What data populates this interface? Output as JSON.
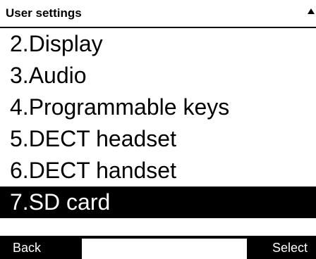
{
  "header": {
    "title": "User settings",
    "scroll_indicator": "triangle-up-icon"
  },
  "menu": {
    "items": [
      {
        "label": "2.Display",
        "selected": false
      },
      {
        "label": "3.Audio",
        "selected": false
      },
      {
        "label": "4.Programmable keys",
        "selected": false
      },
      {
        "label": "5.DECT headset",
        "selected": false
      },
      {
        "label": "6.DECT handset",
        "selected": false
      },
      {
        "label": "7.SD card",
        "selected": true
      }
    ]
  },
  "softkeys": {
    "left_label": "Back",
    "middle_label": "",
    "right_label": "Select"
  },
  "colors": {
    "background": "#ffffff",
    "foreground": "#000000",
    "highlight": "#000000"
  }
}
